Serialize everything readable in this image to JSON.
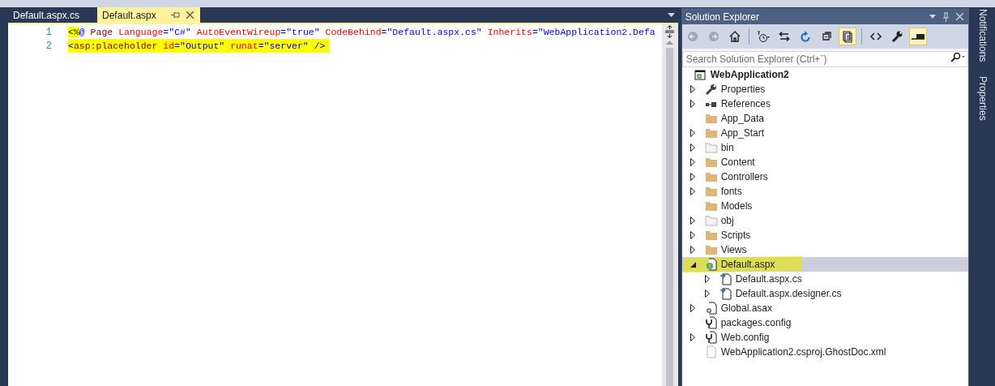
{
  "editor": {
    "tabs": [
      {
        "label": "Default.aspx.cs",
        "selected": false
      },
      {
        "label": "Default.aspx",
        "selected": true
      }
    ],
    "lines": [
      {
        "number": "1",
        "marked": false,
        "tokens": [
          {
            "text": "<%",
            "kind": "delimiter",
            "marked": true
          },
          {
            "text": "@ ",
            "kind": "punct",
            "marked": false
          },
          {
            "text": "Page ",
            "kind": "element",
            "marked": false
          },
          {
            "text": "Language",
            "kind": "attribute",
            "marked": false
          },
          {
            "text": "=\"C#\" ",
            "kind": "value",
            "marked": false
          },
          {
            "text": "AutoEventWireup",
            "kind": "attribute",
            "marked": false
          },
          {
            "text": "=\"true\" ",
            "kind": "value",
            "marked": false
          },
          {
            "text": "CodeBehind",
            "kind": "attribute",
            "marked": false
          },
          {
            "text": "=\"Default.aspx.cs\" ",
            "kind": "value",
            "marked": false
          },
          {
            "text": "Inherits",
            "kind": "attribute",
            "marked": false
          },
          {
            "text": "=\"WebApplication2.Defa",
            "kind": "value",
            "marked": false
          }
        ]
      },
      {
        "number": "2",
        "marked": true,
        "tokens": [
          {
            "text": "<",
            "kind": "punct"
          },
          {
            "text": "asp:placeholder ",
            "kind": "element"
          },
          {
            "text": "id",
            "kind": "attribute"
          },
          {
            "text": "=\"Output\" ",
            "kind": "value"
          },
          {
            "text": "runat",
            "kind": "attribute"
          },
          {
            "text": "=\"server\" ",
            "kind": "value"
          },
          {
            "text": "/>",
            "kind": "punct"
          }
        ]
      }
    ]
  },
  "solution_explorer": {
    "title": "Solution Explorer",
    "search": {
      "placeholder": "Search Solution Explorer (Ctrl+¨)"
    },
    "toolbar": [
      {
        "kind": "back",
        "selected": false
      },
      {
        "kind": "forward",
        "selected": false
      },
      {
        "kind": "home",
        "selected": false
      },
      {
        "kind": "separator"
      },
      {
        "kind": "history",
        "selected": false
      },
      {
        "kind": "sync",
        "selected": false
      },
      {
        "kind": "refresh",
        "selected": false
      },
      {
        "kind": "collapse",
        "selected": false
      },
      {
        "kind": "showall",
        "selected": true
      },
      {
        "kind": "separator"
      },
      {
        "kind": "code",
        "selected": false
      },
      {
        "kind": "wrench",
        "selected": false
      },
      {
        "kind": "preview",
        "selected": true
      }
    ],
    "tree": [
      {
        "label": "WebApplication2",
        "kind": "project",
        "selected": false,
        "marked": false,
        "children": [
          {
            "label": "Properties",
            "kind": "wrench",
            "expandable": true,
            "expanded": false,
            "selected": false,
            "marked": false
          },
          {
            "label": "References",
            "kind": "references",
            "expandable": true,
            "expanded": false,
            "selected": false,
            "marked": false
          },
          {
            "label": "App_Data",
            "kind": "folder",
            "expandable": false,
            "selected": false,
            "marked": false
          },
          {
            "label": "App_Start",
            "kind": "folder",
            "expandable": true,
            "expanded": false,
            "selected": false,
            "marked": false
          },
          {
            "label": "bin",
            "kind": "hidden-folder",
            "expandable": true,
            "expanded": false,
            "selected": false,
            "marked": false
          },
          {
            "label": "Content",
            "kind": "folder",
            "expandable": true,
            "expanded": false,
            "selected": false,
            "marked": false
          },
          {
            "label": "Controllers",
            "kind": "folder",
            "expandable": true,
            "expanded": false,
            "selected": false,
            "marked": false
          },
          {
            "label": "fonts",
            "kind": "folder",
            "expandable": true,
            "expanded": false,
            "selected": false,
            "marked": false
          },
          {
            "label": "Models",
            "kind": "folder",
            "expandable": false,
            "selected": false,
            "marked": false
          },
          {
            "label": "obj",
            "kind": "hidden-folder",
            "expandable": true,
            "expanded": false,
            "selected": false,
            "marked": false
          },
          {
            "label": "Scripts",
            "kind": "folder",
            "expandable": true,
            "expanded": false,
            "selected": false,
            "marked": false
          },
          {
            "label": "Views",
            "kind": "folder",
            "expandable": true,
            "expanded": false,
            "selected": false,
            "marked": false
          },
          {
            "label": "Default.aspx",
            "kind": "web-file",
            "expandable": true,
            "expanded": true,
            "selected": true,
            "marked": true,
            "children": [
              {
                "label": "Default.aspx.cs",
                "kind": "code-file",
                "expandable": true,
                "expanded": false,
                "selected": false,
                "marked": false
              },
              {
                "label": "Default.aspx.designer.cs",
                "kind": "code-file",
                "expandable": true,
                "expanded": false,
                "selected": false,
                "marked": false
              }
            ]
          },
          {
            "label": "Global.asax",
            "kind": "gear-file",
            "expandable": true,
            "expanded": false,
            "selected": false,
            "marked": false
          },
          {
            "label": "packages.config",
            "kind": "config-file",
            "expandable": false,
            "selected": false,
            "marked": false
          },
          {
            "label": "Web.config",
            "kind": "config-file",
            "expandable": true,
            "expanded": false,
            "selected": false,
            "marked": false
          },
          {
            "label": "WebApplication2.csproj.GhostDoc.xml",
            "kind": "hidden-file",
            "expandable": false,
            "selected": false,
            "marked": false
          }
        ]
      }
    ]
  },
  "side_tabs": [
    {
      "label": "Notifications"
    },
    {
      "label": "Properties"
    }
  ]
}
